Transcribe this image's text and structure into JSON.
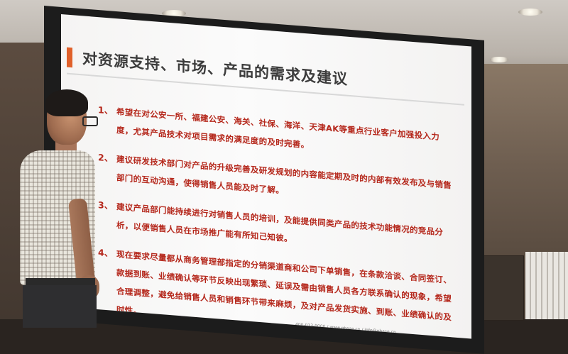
{
  "slide": {
    "title": "对资源支持、市场、产品的需求及建议",
    "accent_color": "#e0602a",
    "text_color": "#b5281c",
    "items": [
      {
        "num": "1、",
        "text": "希望在对公安一所、福建公安、海关、社保、海洋、天津AK等重点行业客户加强投入力度，尤其产品技术对项目需求的满足度的及时完善。"
      },
      {
        "num": "2、",
        "text": "建议研发技术部门对产品的升级完善及研发规划的内容能定期及时的内部有效发布及与销售部门的互动沟通，使得销售人员能及时了解。"
      },
      {
        "num": "3、",
        "text": "建议产品部门能持续进行对销售人员的培训，及能提供同类产品的技术功能情况的竞品分析，以便销售人员在市场推广能有所知己知彼。"
      },
      {
        "num": "4、",
        "text": "现在要求尽量都从商务管理部指定的分销渠道商和公司下单销售，在条款洽谈、合同签订、款据到账、业绩确认等环节反映出现繁琐、延误及需由销售人员各方联系确认的现象，希望合理调整，避免给销售人员和销售环节带来麻烦，及对产品发货实施、到账、业绩确认的及时性。"
      }
    ],
    "footer": "400-013-9000 / www.gbase.cn / info@gbase.cn"
  }
}
